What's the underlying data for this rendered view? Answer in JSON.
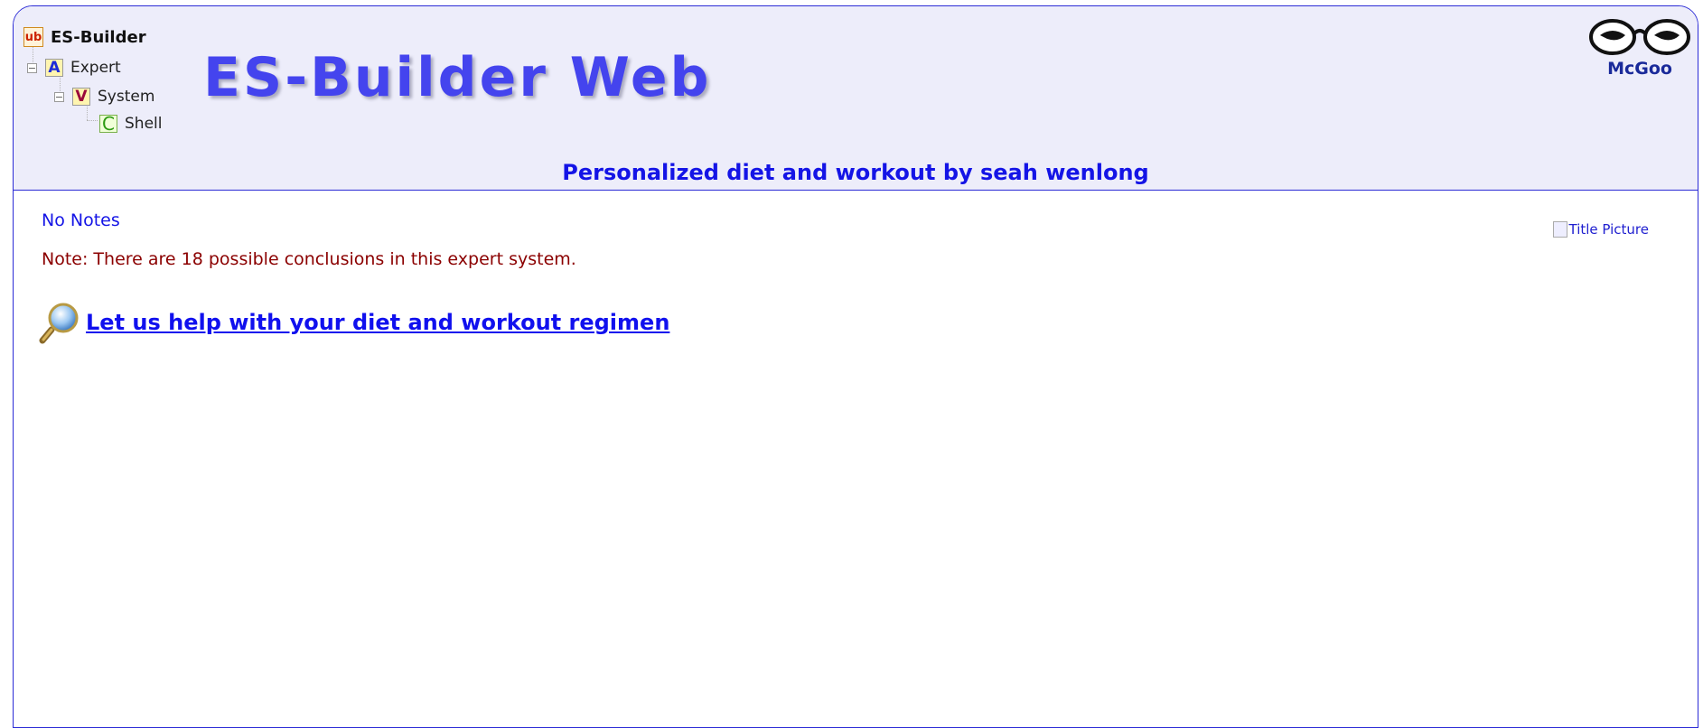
{
  "tree": {
    "root": "ES-Builder",
    "level1": {
      "letter": "A",
      "label": "Expert"
    },
    "level2": {
      "letter": "V",
      "label": "System"
    },
    "level3": {
      "letter": "C",
      "label": "Shell"
    },
    "root_icon_text": "ub"
  },
  "header": {
    "brand": "ES-Builder Web",
    "subtitle": "Personalized diet and workout by seah wenlong",
    "logo_text": "McGoo"
  },
  "main": {
    "notes": "No Notes",
    "note_count": "Note: There are 18 possible conclusions in this expert system.",
    "start_link": "Let us help with your diet and workout regimen",
    "title_picture_alt": "Title Picture"
  },
  "colors": {
    "header_bg": "#ededfa",
    "border": "#2b2bd6",
    "brand": "#4444ee",
    "link": "#1010ee",
    "note_text": "#8b0000"
  },
  "icons": [
    "ub-logo-icon",
    "collapse-icon",
    "magnifier-icon",
    "glasses-logo-icon",
    "broken-image-icon"
  ]
}
